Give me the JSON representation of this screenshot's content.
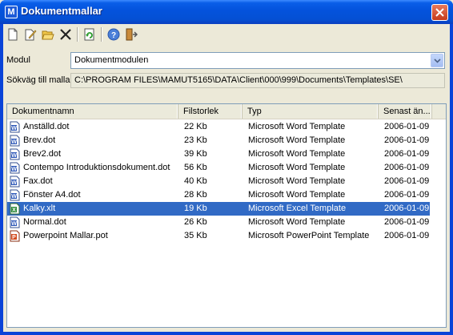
{
  "window": {
    "title": "Dokumentmallar",
    "app_icon_letter": "M"
  },
  "toolbar": {
    "buttons": [
      {
        "icon": "new-document-icon"
      },
      {
        "icon": "edit-document-icon"
      },
      {
        "icon": "open-folder-icon"
      },
      {
        "icon": "delete-icon"
      },
      {
        "icon": "refresh-icon"
      },
      {
        "icon": "help-icon"
      },
      {
        "icon": "exit-icon"
      }
    ]
  },
  "form": {
    "module_label": "Modul",
    "module_value": "Dokumentmodulen",
    "path_label": "Sökväg till mallar",
    "path_value": "C:\\PROGRAM FILES\\MAMUT5165\\DATA\\Client\\000\\999\\Documents\\Templates\\SE\\"
  },
  "list": {
    "columns": [
      "Dokumentnamn",
      "Filstorlek",
      "Typ",
      "Senast än..."
    ],
    "rows": [
      {
        "name": "Anställd.dot",
        "size": "22 Kb",
        "type": "Microsoft Word Template",
        "modified": "2006-01-09",
        "icon": "word-file-icon"
      },
      {
        "name": "Brev.dot",
        "size": "23 Kb",
        "type": "Microsoft Word Template",
        "modified": "2006-01-09",
        "icon": "word-file-icon"
      },
      {
        "name": "Brev2.dot",
        "size": "39 Kb",
        "type": "Microsoft Word Template",
        "modified": "2006-01-09",
        "icon": "word-file-icon"
      },
      {
        "name": "Contempo Introduktionsdokument.dot",
        "size": "56 Kb",
        "type": "Microsoft Word Template",
        "modified": "2006-01-09",
        "icon": "word-file-icon"
      },
      {
        "name": "Fax.dot",
        "size": "40 Kb",
        "type": "Microsoft Word Template",
        "modified": "2006-01-09",
        "icon": "word-file-icon"
      },
      {
        "name": "Fönster A4.dot",
        "size": "28 Kb",
        "type": "Microsoft Word Template",
        "modified": "2006-01-09",
        "icon": "word-file-icon"
      },
      {
        "name": "Kalky.xlt",
        "size": "19 Kb",
        "type": "Microsoft Excel Template",
        "modified": "2006-01-09",
        "icon": "excel-file-icon",
        "selected": true
      },
      {
        "name": "Normal.dot",
        "size": "26 Kb",
        "type": "Microsoft Word Template",
        "modified": "2006-01-09",
        "icon": "word-file-icon"
      },
      {
        "name": "Powerpoint Mallar.pot",
        "size": "35 Kb",
        "type": "Microsoft PowerPoint Template",
        "modified": "2006-01-09",
        "icon": "powerpoint-file-icon"
      }
    ]
  },
  "colors": {
    "titlebar": "#0453dd",
    "selection": "#316ac5",
    "face": "#ece9d8"
  }
}
